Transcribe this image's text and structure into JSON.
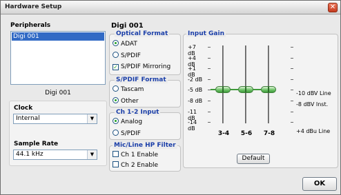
{
  "window": {
    "title": "Hardware Setup"
  },
  "peripherals": {
    "heading": "Peripherals",
    "items": [
      "Digi 001"
    ],
    "selected_caption": "Digi 001"
  },
  "clock": {
    "label": "Clock",
    "value": "Internal"
  },
  "sample_rate": {
    "label": "Sample Rate",
    "value": "44.1 kHz"
  },
  "device_title": "Digi 001",
  "optical_format": {
    "legend": "Optical Format",
    "options": [
      {
        "label": "ADAT",
        "checked": true
      },
      {
        "label": "S/PDIF",
        "checked": false
      }
    ],
    "mirroring_label": "S/PDIF Mirroring",
    "mirroring_checked": true
  },
  "spdif_format": {
    "legend": "S/PDIF Format",
    "options": [
      {
        "label": "Tascam",
        "checked": false
      },
      {
        "label": "Other",
        "checked": true
      }
    ]
  },
  "ch12_input": {
    "legend": "Ch 1-2 Input",
    "options": [
      {
        "label": "Analog",
        "checked": true
      },
      {
        "label": "S/PDIF",
        "checked": false
      }
    ]
  },
  "hp_filter": {
    "legend": "Mic/Line HP Filter",
    "options": [
      {
        "label": "Ch 1 Enable",
        "checked": false
      },
      {
        "label": "Ch 2 Enable",
        "checked": false
      }
    ]
  },
  "input_gain": {
    "legend": "Input Gain",
    "db_marks": [
      "+7 dB",
      "+4 dB",
      "+1 dB",
      "-2 dB",
      "-5 dB",
      "-8 dB",
      "-11 dB",
      "-14 dB"
    ],
    "right_labels": {
      "top": "-10 dBV Line",
      "mid": "-8 dBV Inst.",
      "bottom": "+4 dBu Line"
    },
    "channels": [
      {
        "label": "3-4",
        "gain_db": -5
      },
      {
        "label": "5-6",
        "gain_db": -5
      },
      {
        "label": "7-8",
        "gain_db": -5
      }
    ],
    "default_label": "Default"
  },
  "ok_label": "OK",
  "colors": {
    "accent": "#1a3ea8",
    "selection": "#316ac5",
    "knob": "#6fc36a"
  },
  "icons": {
    "close": "close-icon",
    "dropdown": "chevron-down-icon"
  }
}
